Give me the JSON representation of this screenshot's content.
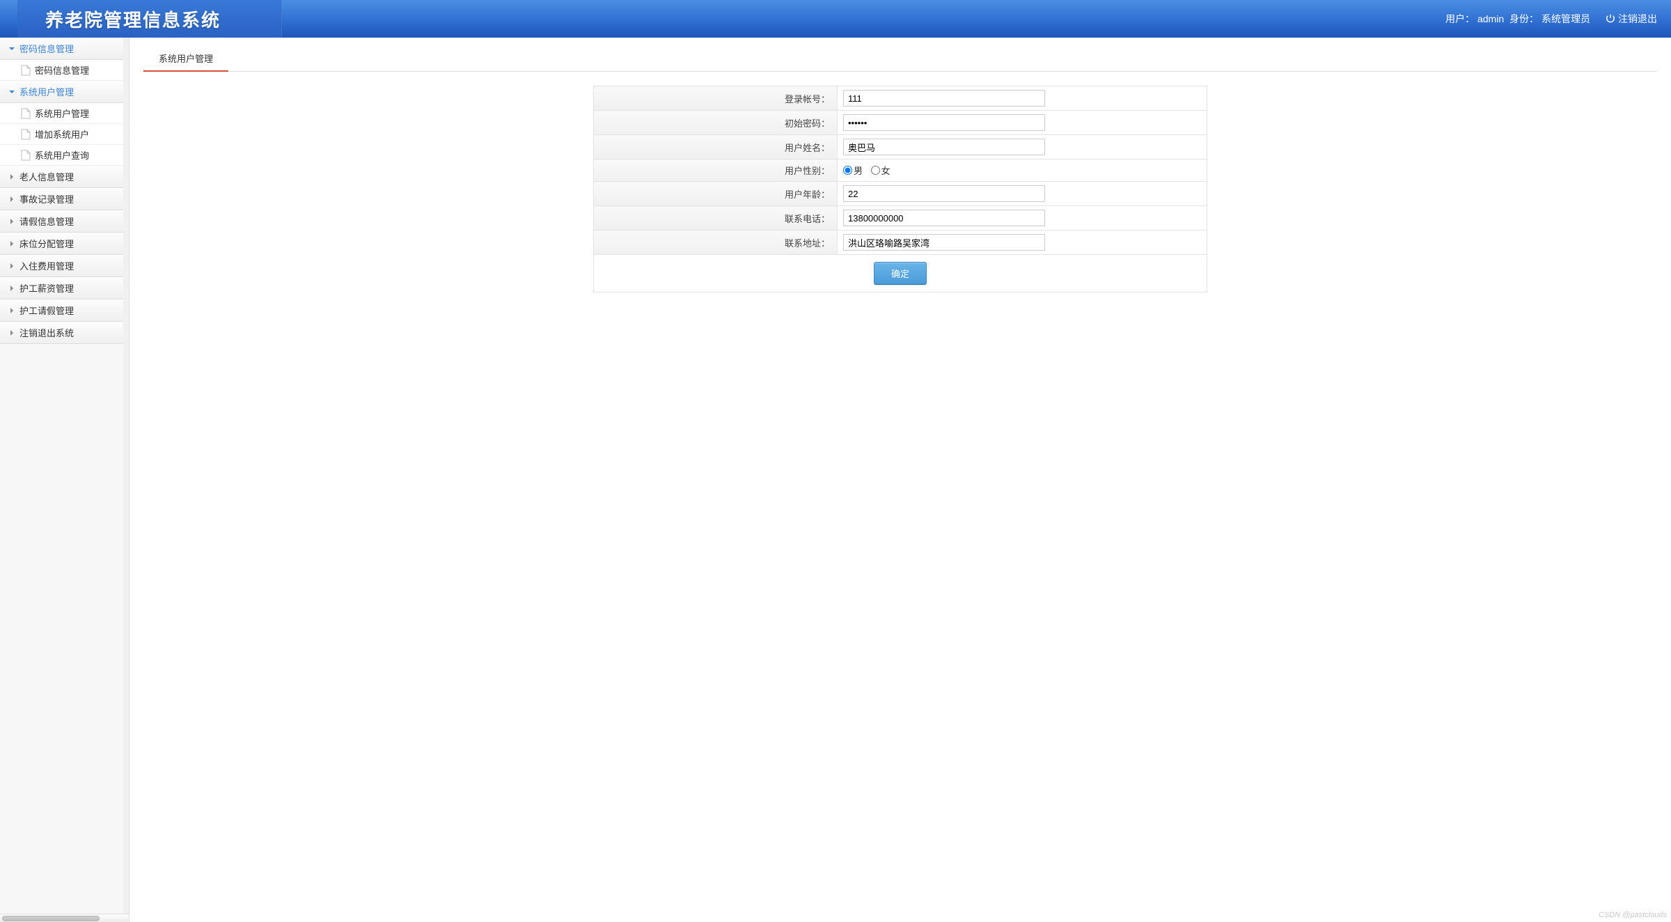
{
  "header": {
    "title": "养老院管理信息系统",
    "user_label": "用户：",
    "user_value": "admin",
    "role_label": "身份：",
    "role_value": "系统管理员",
    "logout": "注销退出"
  },
  "sidebar": {
    "sections": [
      {
        "label": "密码信息管理",
        "open": true,
        "items": [
          {
            "label": "密码信息管理"
          }
        ]
      },
      {
        "label": "系统用户管理",
        "open": true,
        "items": [
          {
            "label": "系统用户管理"
          },
          {
            "label": "增加系统用户"
          },
          {
            "label": "系统用户查询"
          }
        ]
      },
      {
        "label": "老人信息管理",
        "open": false,
        "items": []
      },
      {
        "label": "事故记录管理",
        "open": false,
        "items": []
      },
      {
        "label": "请假信息管理",
        "open": false,
        "items": []
      },
      {
        "label": "床位分配管理",
        "open": false,
        "items": []
      },
      {
        "label": "入住费用管理",
        "open": false,
        "items": []
      },
      {
        "label": "护工薪资管理",
        "open": false,
        "items": []
      },
      {
        "label": "护工请假管理",
        "open": false,
        "items": []
      },
      {
        "label": "注销退出系统",
        "open": false,
        "items": []
      }
    ]
  },
  "tabs": {
    "active": "系统用户管理"
  },
  "form": {
    "fields": {
      "account": {
        "label": "登录帐号：",
        "value": "111"
      },
      "password": {
        "label": "初始密码：",
        "value": "••••••"
      },
      "name": {
        "label": "用户姓名：",
        "value": "奥巴马"
      },
      "gender": {
        "label": "用户性别：",
        "male": "男",
        "female": "女",
        "selected": "male"
      },
      "age": {
        "label": "用户年龄：",
        "value": "22"
      },
      "phone": {
        "label": "联系电话：",
        "value": "13800000000"
      },
      "address": {
        "label": "联系地址：",
        "value": "洪山区珞喻路吴家湾"
      }
    },
    "submit": "确定"
  },
  "watermark": "CSDN @pastclouds"
}
